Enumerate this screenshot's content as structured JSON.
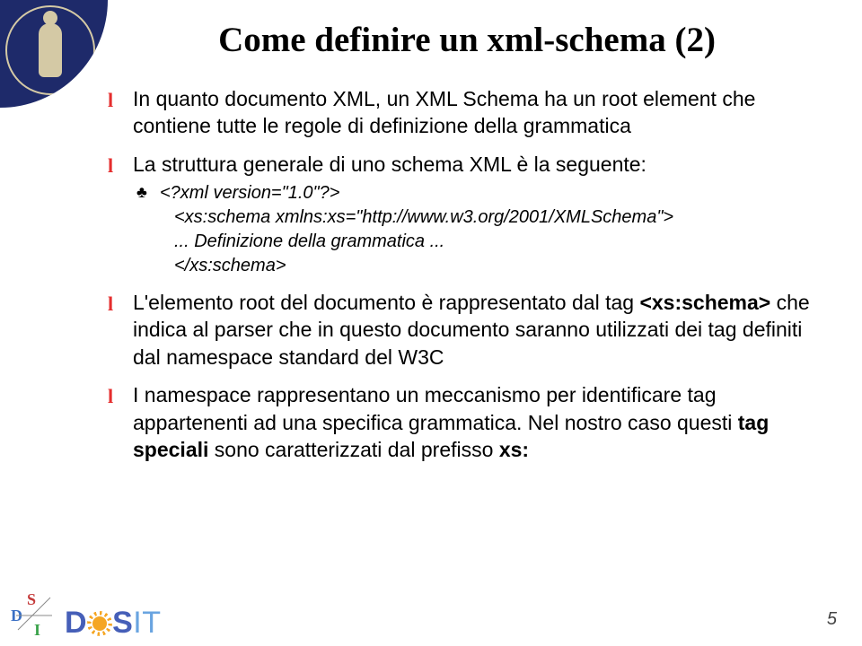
{
  "title": "Come definire un xml-schema (2)",
  "bullets": [
    {
      "text": "In quanto documento XML, un XML Schema ha un root element che contiene tutte le regole di definizione della grammatica"
    },
    {
      "text": "La struttura generale di uno schema XML è la seguente:",
      "code": [
        "<?xml version=\"1.0\"?>",
        "<xs:schema xmlns:xs=\"http://www.w3.org/2001/XMLSchema\">",
        "... Definizione della grammatica ...",
        "</xs:schema>"
      ]
    },
    {
      "html": "L'elemento root del documento è rappresentato dal tag <b class=\"term\">&lt;xs:schema&gt;</b> che indica al parser che in questo documento saranno utilizzati dei tag definiti dal namespace standard del W3C"
    },
    {
      "html": "I namespace rappresentano un meccanismo per identificare tag appartenenti ad una specifica grammatica. Nel nostro caso questi <b class=\"term\">tag speciali</b> sono caratterizzati dal prefisso <b class=\"term\">xs:</b>"
    }
  ],
  "pageNumber": "5",
  "bulletMarker": "l",
  "subMarker": "♣",
  "footer": {
    "disit": "DISIT",
    "sdi": {
      "s": "S",
      "d": "D",
      "i": "I"
    }
  }
}
